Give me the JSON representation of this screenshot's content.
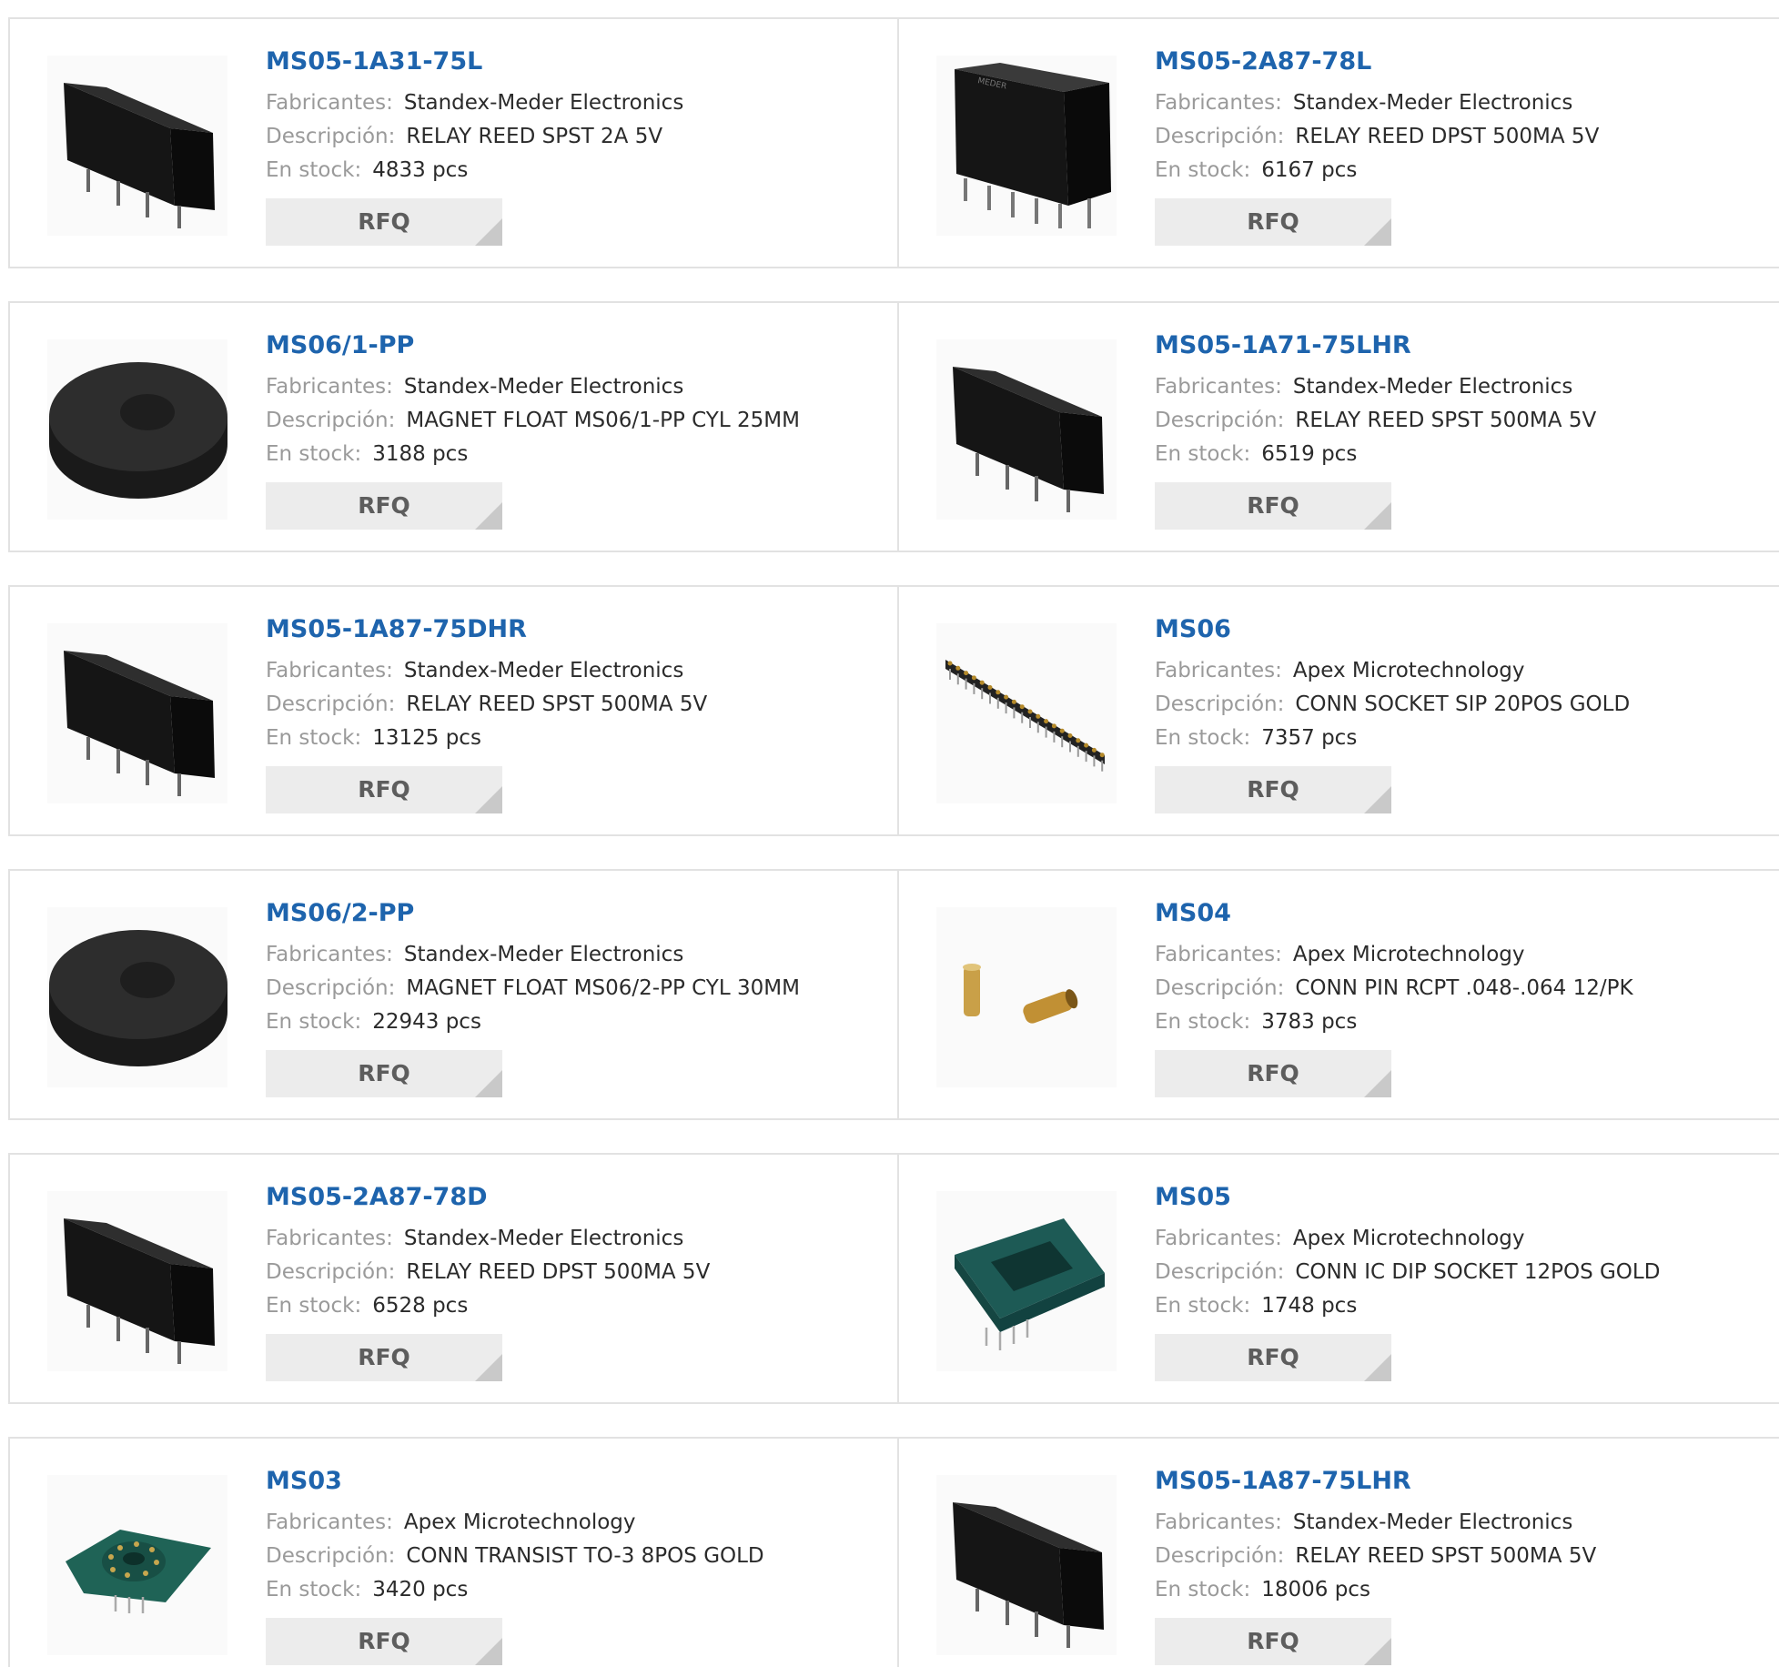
{
  "labels": {
    "manufacturer": "Fabricantes:",
    "description": "Descripción:",
    "stock": "En stock:",
    "stock_unit": "pcs",
    "rfq": "RFQ"
  },
  "colors": {
    "title": "#1e64ad",
    "label": "#9a9a9a",
    "value": "#2b2b2b",
    "button_bg": "#ececec",
    "button_text": "#5d5d5d",
    "border": "#e2e2e2"
  },
  "products": [
    {
      "part": "MS05-1A31-75L",
      "manufacturer": "Standex-Meder Electronics",
      "description": "RELAY REED SPST 2A 5V",
      "stock": "4833",
      "image": "relay-icon"
    },
    {
      "part": "MS05-2A87-78L",
      "manufacturer": "Standex-Meder Electronics",
      "description": "RELAY REED DPST 500MA 5V",
      "stock": "6167",
      "image": "relay-tall-icon"
    },
    {
      "part": "MS06/1-PP",
      "manufacturer": "Standex-Meder Electronics",
      "description": "MAGNET FLOAT MS06/1-PP CYL 25MM",
      "stock": "3188",
      "image": "magnet-float-icon"
    },
    {
      "part": "MS05-1A71-75LHR",
      "manufacturer": "Standex-Meder Electronics",
      "description": "RELAY REED SPST 500MA 5V",
      "stock": "6519",
      "image": "relay-icon"
    },
    {
      "part": "MS05-1A87-75DHR",
      "manufacturer": "Standex-Meder Electronics",
      "description": "RELAY REED SPST 500MA 5V",
      "stock": "13125",
      "image": "relay-icon"
    },
    {
      "part": "MS06",
      "manufacturer": "Apex Microtechnology",
      "description": "CONN SOCKET SIP 20POS GOLD",
      "stock": "7357",
      "image": "sip-socket-icon"
    },
    {
      "part": "MS06/2-PP",
      "manufacturer": "Standex-Meder Electronics",
      "description": "MAGNET FLOAT MS06/2-PP CYL 30MM",
      "stock": "22943",
      "image": "magnet-float-icon"
    },
    {
      "part": "MS04",
      "manufacturer": "Apex Microtechnology",
      "description": "CONN PIN RCPT .048-.064 12/PK",
      "stock": "3783",
      "image": "pin-receptacle-icon"
    },
    {
      "part": "MS05-2A87-78D",
      "manufacturer": "Standex-Meder Electronics",
      "description": "RELAY REED DPST 500MA 5V",
      "stock": "6528",
      "image": "relay-icon"
    },
    {
      "part": "MS05",
      "manufacturer": "Apex Microtechnology",
      "description": "CONN IC DIP SOCKET 12POS GOLD",
      "stock": "1748",
      "image": "dip-socket-icon"
    },
    {
      "part": "MS03",
      "manufacturer": "Apex Microtechnology",
      "description": "CONN TRANSIST TO-3 8POS GOLD",
      "stock": "3420",
      "image": "to3-socket-icon"
    },
    {
      "part": "MS05-1A87-75LHR",
      "manufacturer": "Standex-Meder Electronics",
      "description": "RELAY REED SPST 500MA 5V",
      "stock": "18006",
      "image": "relay-icon"
    }
  ]
}
